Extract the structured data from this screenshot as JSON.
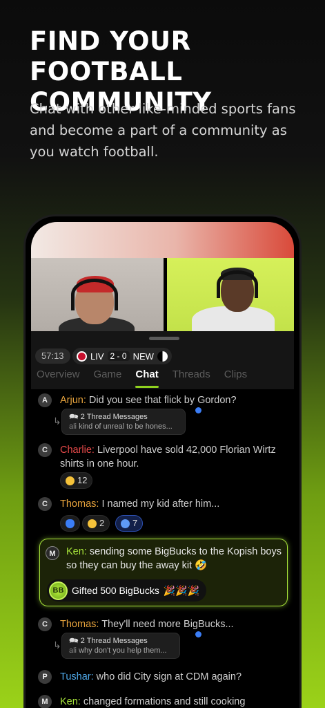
{
  "headline": "FIND YOUR FOOTBALL COMMUNITY",
  "subtitle": "Chat with other like-minded sports fans and become a part of a community as you watch football.",
  "match": {
    "time": "57:13",
    "home": "LIV",
    "home_score": "2",
    "separator": "-",
    "away_score": "0",
    "away": "NEW"
  },
  "tabs": [
    "Overview",
    "Game",
    "Chat",
    "Threads",
    "Clips"
  ],
  "active_tab": "Chat",
  "messages": [
    {
      "initial": "A",
      "name": "Arjun:",
      "name_color": "#e8a43d",
      "text": "Did you see that flick by Gordon?"
    },
    {
      "initial": "C",
      "name": "Charlie:",
      "name_color": "#e84a4a",
      "text": "Liverpool have sold 42,000 Florian Wirtz shirts in one hour."
    },
    {
      "initial": "C",
      "name": "Thomas:",
      "name_color": "#e8a43d",
      "text": "I named my kid after him..."
    },
    {
      "initial": "M",
      "name": "Ken:",
      "name_color": "#a7e43a",
      "text": "sending some BigBucks to the Kopish boys so they can buy the away kit 🤣"
    },
    {
      "initial": "C",
      "name": "Thomas:",
      "name_color": "#e8a43d",
      "text": "They'll need more BigBucks..."
    },
    {
      "initial": "P",
      "name": "Tushar:",
      "name_color": "#4fa8e8",
      "text": "who did City sign at CDM again?"
    },
    {
      "initial": "M",
      "name": "Ken:",
      "name_color": "#a7e43a",
      "text": "changed formations and still cooking"
    }
  ],
  "threads": [
    {
      "title": "2 Thread Messages",
      "preview_user": "ali",
      "preview": "kind of unreal to be hones..."
    },
    {
      "title": "2 Thread Messages",
      "preview_user": "ali",
      "preview": "why don't you help them..."
    }
  ],
  "reactions": {
    "charlie": [
      {
        "icon": "smile-emoji-icon",
        "count": "12"
      }
    ],
    "thomas": [
      {
        "icon": "blue-heart-icon",
        "count": ""
      },
      {
        "icon": "laughing-emoji-icon",
        "count": "2"
      },
      {
        "icon": "blue-mask-emoji-icon",
        "count": "7"
      }
    ]
  },
  "gift": {
    "coin_label": "BB",
    "label": "Gifted 500 BigBucks",
    "emojis": "🎉🎉🎉"
  },
  "colors": {
    "accent": "#a7e43a",
    "unread_dot": "#3b7df5"
  }
}
